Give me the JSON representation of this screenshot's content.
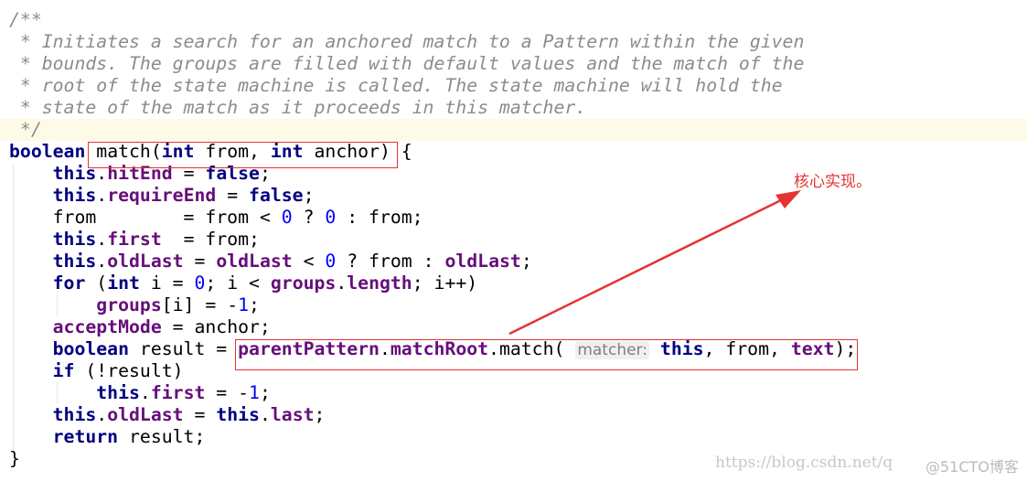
{
  "code_lines": [
    [
      {
        "t": "/**",
        "c": "comment"
      }
    ],
    [
      {
        "t": " * Initiates a search for an anchored match to a Pattern within the given",
        "c": "comment"
      }
    ],
    [
      {
        "t": " * bounds. The groups are filled with default values and the match of the",
        "c": "comment"
      }
    ],
    [
      {
        "t": " * root of the state machine is called. The state machine will hold the",
        "c": "comment"
      }
    ],
    [
      {
        "t": " * state of the match as it proceeds in this matcher.",
        "c": "comment"
      }
    ],
    [
      {
        "t": " */",
        "c": "comment"
      }
    ],
    [
      {
        "t": "boolean",
        "c": "kw"
      },
      {
        "t": " match(",
        "c": "plain"
      },
      {
        "t": "int",
        "c": "kw"
      },
      {
        "t": " from, ",
        "c": "plain"
      },
      {
        "t": "int",
        "c": "kw"
      },
      {
        "t": " anchor) {",
        "c": "plain"
      }
    ],
    [
      {
        "t": "    this",
        "c": "kw"
      },
      {
        "t": ".",
        "c": "plain"
      },
      {
        "t": "hitEnd",
        "c": "field"
      },
      {
        "t": " = ",
        "c": "plain"
      },
      {
        "t": "false",
        "c": "kw"
      },
      {
        "t": ";",
        "c": "plain"
      }
    ],
    [
      {
        "t": "    this",
        "c": "kw"
      },
      {
        "t": ".",
        "c": "plain"
      },
      {
        "t": "requireEnd",
        "c": "field"
      },
      {
        "t": " = ",
        "c": "plain"
      },
      {
        "t": "false",
        "c": "kw"
      },
      {
        "t": ";",
        "c": "plain"
      }
    ],
    [
      {
        "t": "    from        = from < ",
        "c": "plain"
      },
      {
        "t": "0",
        "c": "num"
      },
      {
        "t": " ? ",
        "c": "plain"
      },
      {
        "t": "0",
        "c": "num"
      },
      {
        "t": " : from;",
        "c": "plain"
      }
    ],
    [
      {
        "t": "    this",
        "c": "kw"
      },
      {
        "t": ".",
        "c": "plain"
      },
      {
        "t": "first",
        "c": "field"
      },
      {
        "t": "  = from;",
        "c": "plain"
      }
    ],
    [
      {
        "t": "    this",
        "c": "kw"
      },
      {
        "t": ".",
        "c": "plain"
      },
      {
        "t": "oldLast",
        "c": "field"
      },
      {
        "t": " = ",
        "c": "plain"
      },
      {
        "t": "oldLast",
        "c": "field"
      },
      {
        "t": " < ",
        "c": "plain"
      },
      {
        "t": "0",
        "c": "num"
      },
      {
        "t": " ? from : ",
        "c": "plain"
      },
      {
        "t": "oldLast",
        "c": "field"
      },
      {
        "t": ";",
        "c": "plain"
      }
    ],
    [
      {
        "t": "    for",
        "c": "kw"
      },
      {
        "t": " (",
        "c": "plain"
      },
      {
        "t": "int",
        "c": "kw"
      },
      {
        "t": " i = ",
        "c": "plain"
      },
      {
        "t": "0",
        "c": "num"
      },
      {
        "t": "; i < ",
        "c": "plain"
      },
      {
        "t": "groups",
        "c": "field"
      },
      {
        "t": ".",
        "c": "plain"
      },
      {
        "t": "length",
        "c": "field"
      },
      {
        "t": "; i++)",
        "c": "plain"
      }
    ],
    [
      {
        "t": "        groups",
        "c": "field"
      },
      {
        "t": "[i] = -",
        "c": "plain"
      },
      {
        "t": "1",
        "c": "num"
      },
      {
        "t": ";",
        "c": "plain"
      }
    ],
    [
      {
        "t": "    acceptMode",
        "c": "field"
      },
      {
        "t": " = anchor;",
        "c": "plain"
      }
    ],
    [
      {
        "t": "    boolean",
        "c": "kw"
      },
      {
        "t": " result = ",
        "c": "plain"
      },
      {
        "t": "parentPattern",
        "c": "field"
      },
      {
        "t": ".",
        "c": "plain"
      },
      {
        "t": "matchRoot",
        "c": "field"
      },
      {
        "t": ".match( ",
        "c": "plain"
      },
      {
        "t": "matcher:",
        "c": "hint"
      },
      {
        "t": " ",
        "c": "plain"
      },
      {
        "t": "this",
        "c": "kw"
      },
      {
        "t": ", from, ",
        "c": "plain"
      },
      {
        "t": "text",
        "c": "field"
      },
      {
        "t": ");",
        "c": "plain"
      }
    ],
    [
      {
        "t": "    if",
        "c": "kw"
      },
      {
        "t": " (!result)",
        "c": "plain"
      }
    ],
    [
      {
        "t": "        this",
        "c": "kw"
      },
      {
        "t": ".",
        "c": "plain"
      },
      {
        "t": "first",
        "c": "field"
      },
      {
        "t": " = -",
        "c": "plain"
      },
      {
        "t": "1",
        "c": "num"
      },
      {
        "t": ";",
        "c": "plain"
      }
    ],
    [
      {
        "t": "    this",
        "c": "kw"
      },
      {
        "t": ".",
        "c": "plain"
      },
      {
        "t": "oldLast",
        "c": "field"
      },
      {
        "t": " = ",
        "c": "plain"
      },
      {
        "t": "this",
        "c": "kw"
      },
      {
        "t": ".",
        "c": "plain"
      },
      {
        "t": "last",
        "c": "field"
      },
      {
        "t": ";",
        "c": "plain"
      }
    ],
    [
      {
        "t": "    return",
        "c": "kw"
      },
      {
        "t": " result;",
        "c": "plain"
      }
    ],
    [
      {
        "t": "}",
        "c": "plain"
      }
    ]
  ],
  "current_line": 5,
  "annotation": "核心实现。",
  "annotation_color": "#e53333",
  "watermark": "https://blog.csdn.net/q",
  "watermark_overlay": "@51CTO博客"
}
